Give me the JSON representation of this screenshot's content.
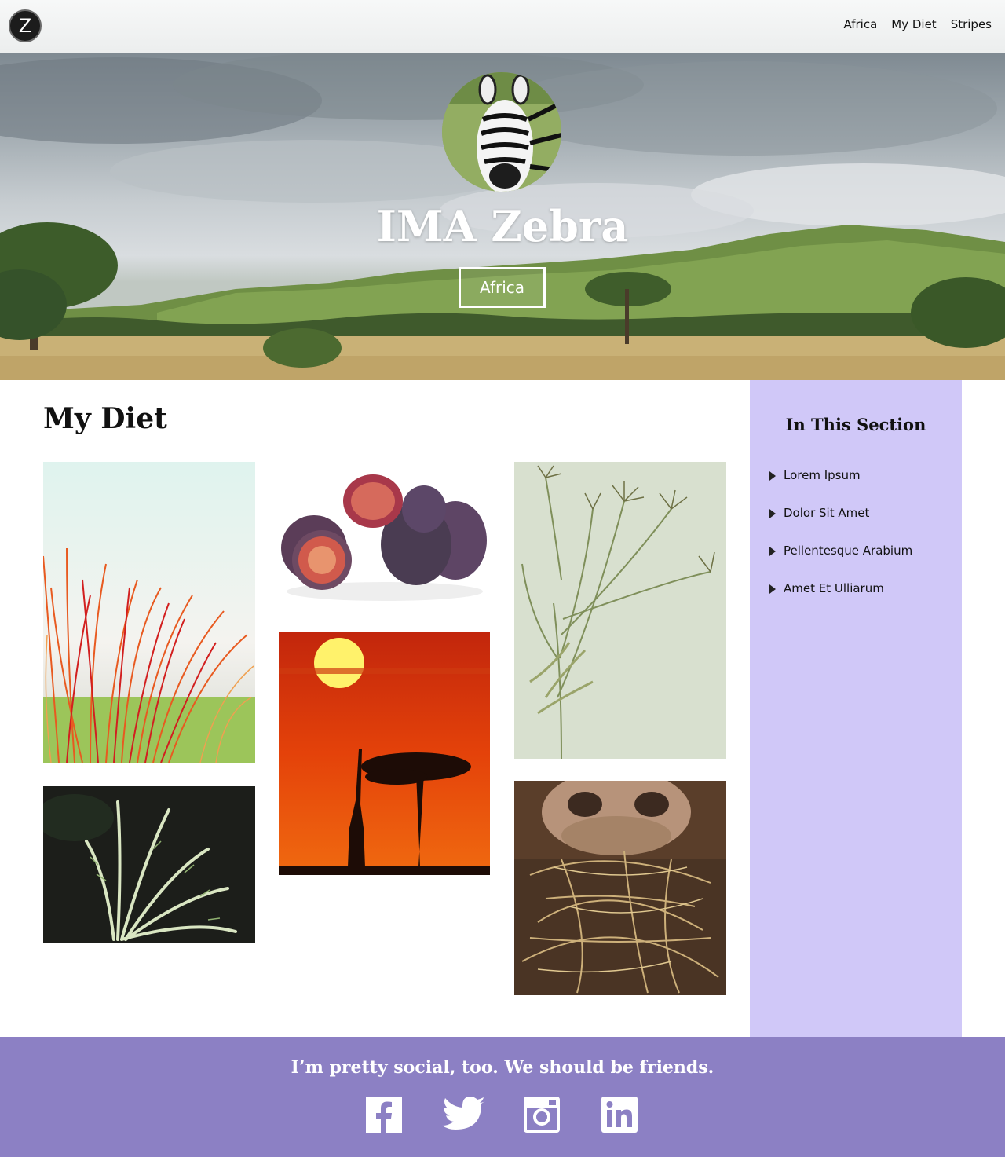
{
  "nav": {
    "logo_letter": "Z",
    "links": [
      "Africa",
      "My Diet",
      "Stripes"
    ]
  },
  "hero": {
    "title": "IMA Zebra",
    "button_label": "Africa"
  },
  "main": {
    "title": "My Diet",
    "gallery": [
      "red-grass-photo",
      "figs-photo",
      "seed-grass-photo",
      "grass-plume-photo",
      "sunset-giraffe-photo",
      "zebra-eating-hay-photo"
    ]
  },
  "sidebar": {
    "title": "In This Section",
    "items": [
      "Lorem Ipsum",
      "Dolor Sit Amet",
      "Pellentesque Arabium",
      "Amet Et Ulliarum"
    ]
  },
  "footer": {
    "text": "I’m pretty social, too. We should be friends.",
    "icons": [
      "facebook-icon",
      "twitter-icon",
      "instagram-icon",
      "linkedin-icon"
    ]
  },
  "colors": {
    "sidebar_bg": "#d0c8f8",
    "footer_bg": "#8c80c4",
    "nav_bg": "#f1f2f2"
  }
}
